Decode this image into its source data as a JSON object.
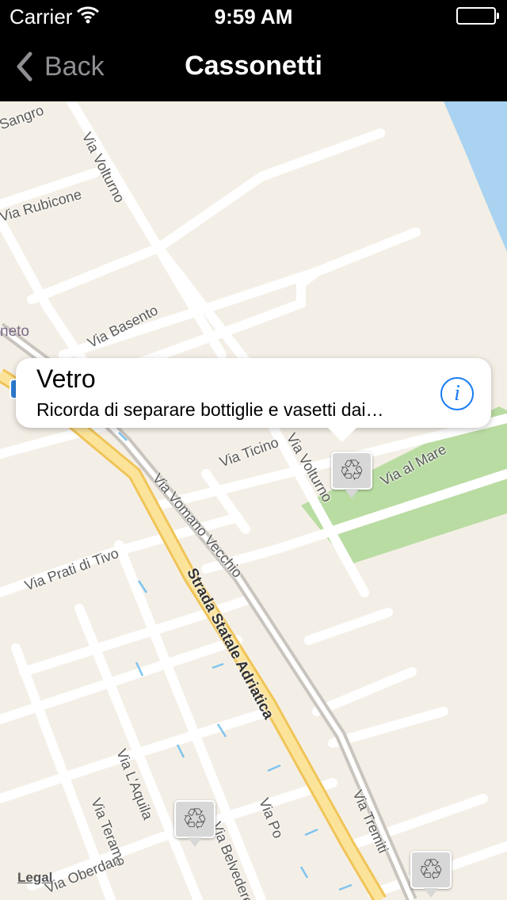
{
  "status_bar": {
    "carrier": "Carrier",
    "time": "9:59 AM",
    "battery_percent": 100
  },
  "nav": {
    "back_label": "Back",
    "title": "Cassonetti"
  },
  "map": {
    "streets": [
      "Via Rubicone",
      "Via Volturno",
      "Via Basento",
      "Via Ticino",
      "Via Volturno",
      "Via al Mare",
      "Via Vomano Vecchio",
      "Via Prati di Tivo",
      "Strada Statale Adriatica",
      "Via L'Aquila",
      "Via Teramo",
      "Via Belvedere",
      "Via Po",
      "Via Tremiti",
      "Via Oberdan"
    ],
    "partial_labels": [
      "neto",
      "Sangro"
    ],
    "legal": "Legal"
  },
  "callout": {
    "title": "Vetro",
    "subtitle": "Ricorda di separare bottiglie e vasetti dai…",
    "info_icon": "i"
  },
  "pins": [
    {
      "icon": "recycle-icon",
      "glyph": "♲"
    },
    {
      "icon": "recycle-icon",
      "glyph": "♲"
    },
    {
      "icon": "recycle-icon",
      "glyph": "♲"
    }
  ]
}
